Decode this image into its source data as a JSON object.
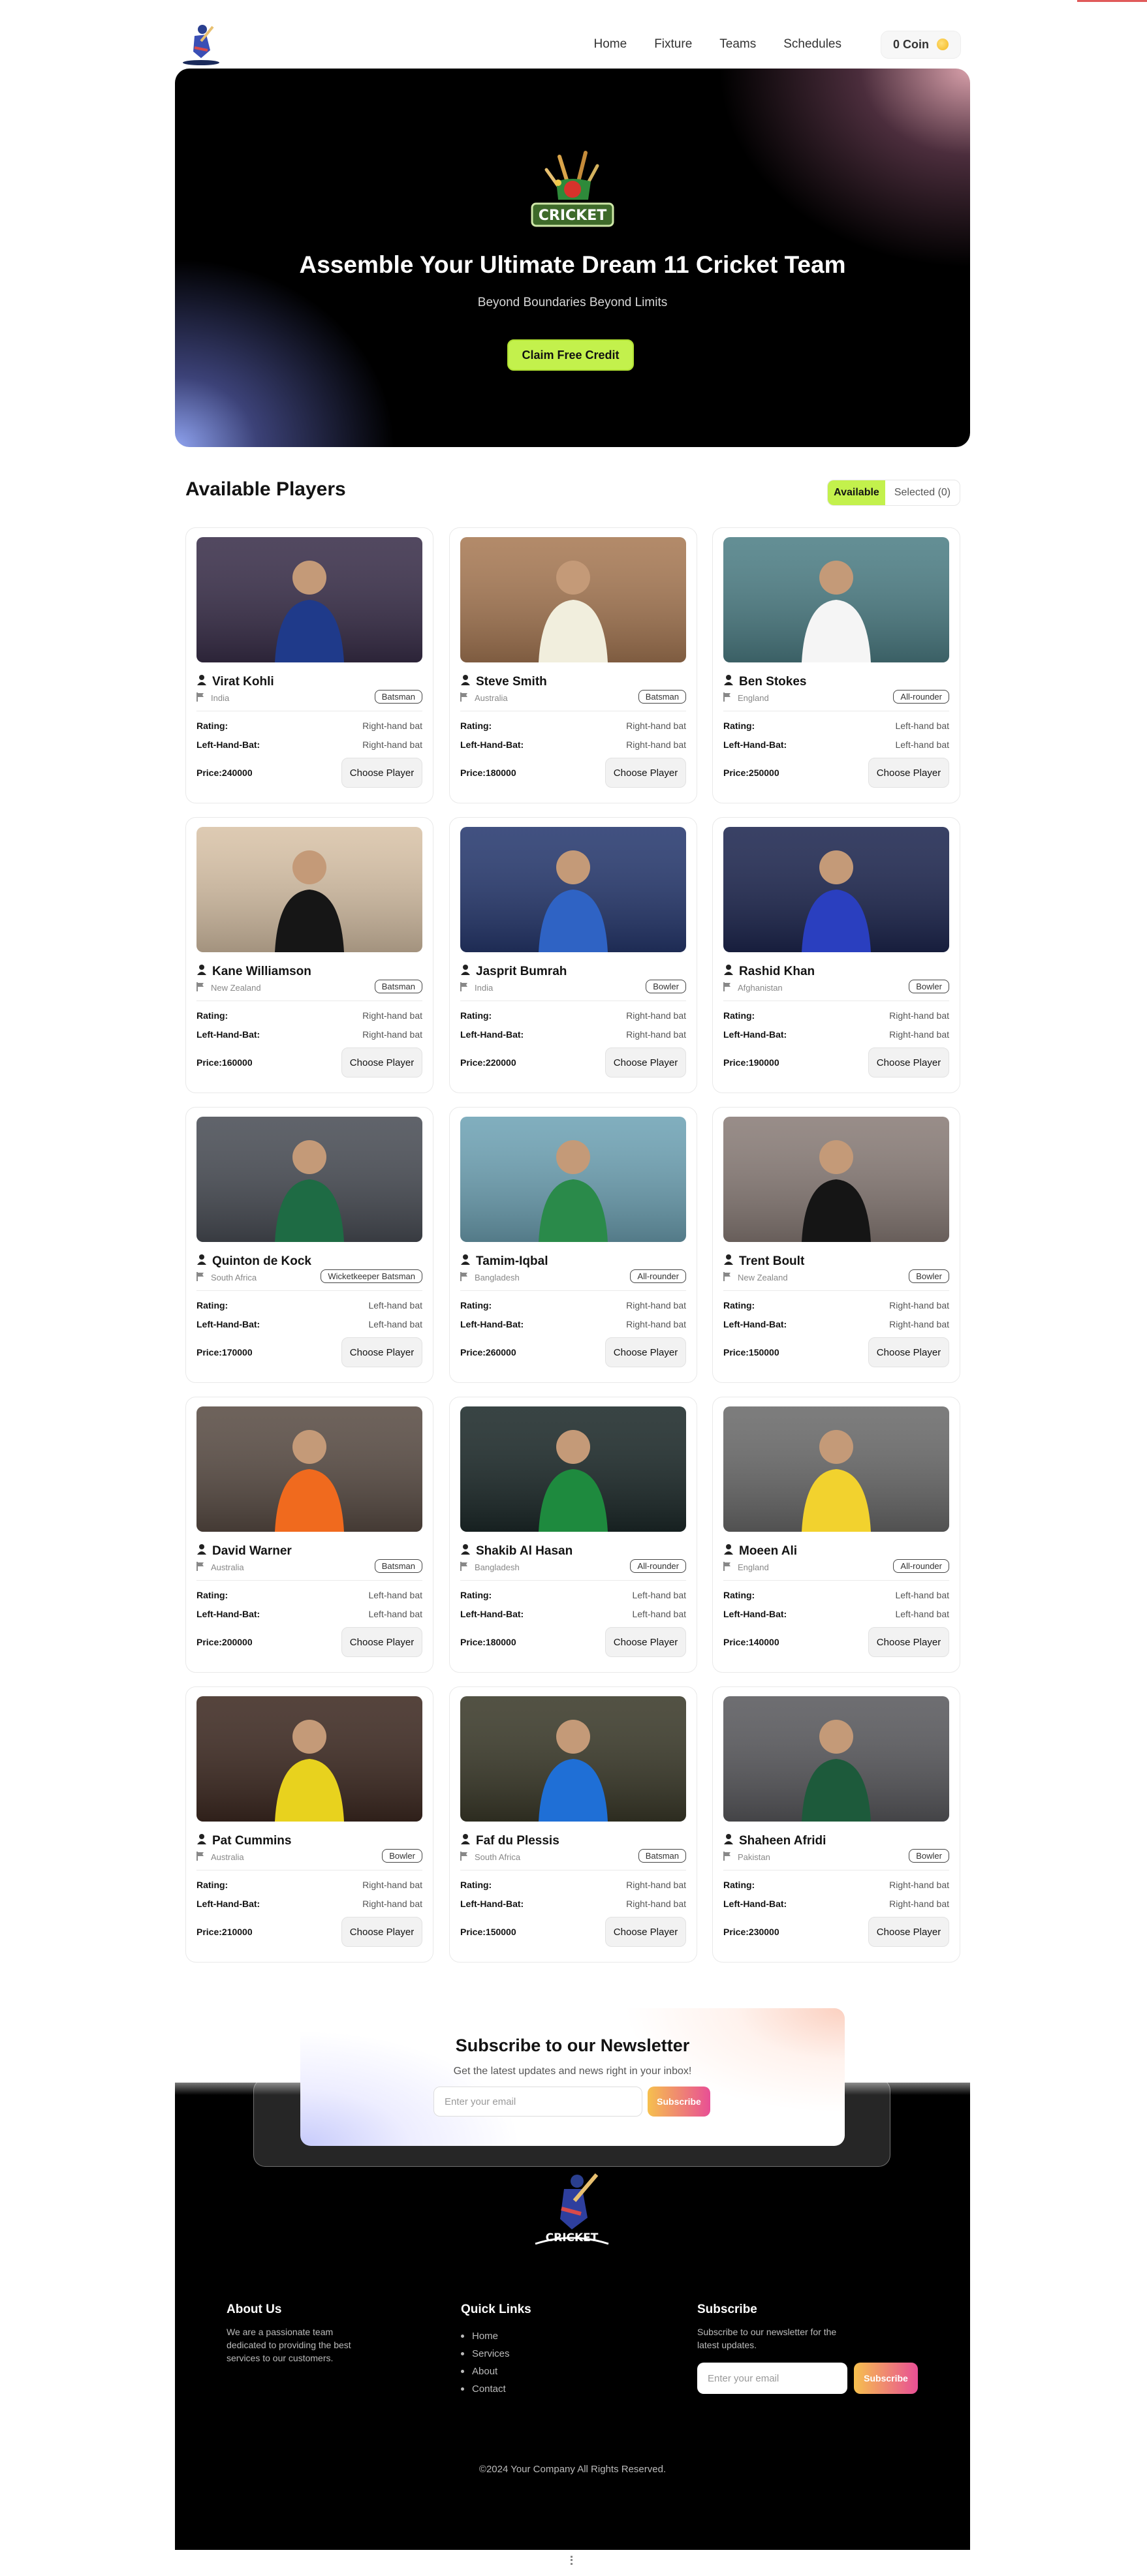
{
  "nav": {
    "links": [
      "Home",
      "Fixture",
      "Teams",
      "Schedules"
    ],
    "coin_label": "0 Coin"
  },
  "hero": {
    "banner_text": "CRICKET",
    "title": "Assemble Your Ultimate Dream 11 Cricket Team",
    "subtitle": "Beyond Boundaries Beyond Limits",
    "button": "Claim Free Credit"
  },
  "players_section": {
    "title": "Available Players",
    "tab_available": "Available",
    "tab_selected": "Selected (0)"
  },
  "labels": {
    "rating": "Rating:",
    "hand": "Left-Hand-Bat:",
    "choose": "Choose Player"
  },
  "players": [
    {
      "name": "Virat Kohli",
      "country": "India",
      "role": "Batsman",
      "rating": "Right-hand bat",
      "hand": "Right-hand bat",
      "price": "Price:240000",
      "jersey": "#1f3a8a",
      "bg": "#3a2f4a"
    },
    {
      "name": "Steve Smith",
      "country": "Australia",
      "role": "Batsman",
      "rating": "Right-hand bat",
      "hand": "Right-hand bat",
      "price": "Price:180000",
      "jersey": "#f1eedd",
      "bg": "#a87a55"
    },
    {
      "name": "Ben Stokes",
      "country": "England",
      "role": "All-rounder",
      "rating": "Left-hand bat",
      "hand": "Left-hand bat",
      "price": "Price:250000",
      "jersey": "#f5f5f5",
      "bg": "#4e7f86"
    },
    {
      "name": "Kane Williamson",
      "country": "New Zealand",
      "role": "Batsman",
      "rating": "Right-hand bat",
      "hand": "Right-hand bat",
      "price": "Price:160000",
      "jersey": "#161616",
      "bg": "#d9c3a8"
    },
    {
      "name": "Jasprit Bumrah",
      "country": "India",
      "role": "Bowler",
      "rating": "Right-hand bat",
      "hand": "Right-hand bat",
      "price": "Price:220000",
      "jersey": "#2f63c4",
      "bg": "#27396f"
    },
    {
      "name": "Rashid Khan",
      "country": "Afghanistan",
      "role": "Bowler",
      "rating": "Right-hand bat",
      "hand": "Right-hand bat",
      "price": "Price:190000",
      "jersey": "#2a3fbf",
      "bg": "#1e2750"
    },
    {
      "name": "Quinton de Kock",
      "country": "South Africa",
      "role": "Wicketkeeper Batsman",
      "rating": "Left-hand bat",
      "hand": "Left-hand bat",
      "price": "Price:170000",
      "jersey": "#1e6b44",
      "bg": "#4a4e56"
    },
    {
      "name": "Tamim-Iqbal",
      "country": "Bangladesh",
      "role": "All-rounder",
      "rating": "Right-hand bat",
      "hand": "Right-hand bat",
      "price": "Price:260000",
      "jersey": "#2a8a4a",
      "bg": "#6fa3b5"
    },
    {
      "name": "Trent Boult",
      "country": "New Zealand",
      "role": "Bowler",
      "rating": "Right-hand bat",
      "hand": "Right-hand bat",
      "price": "Price:150000",
      "jersey": "#151515",
      "bg": "#8a7d78"
    },
    {
      "name": "David Warner",
      "country": "Australia",
      "role": "Batsman",
      "rating": "Left-hand bat",
      "hand": "Left-hand bat",
      "price": "Price:200000",
      "jersey": "#f06a1e",
      "bg": "#5a4d45"
    },
    {
      "name": "Shakib Al Hasan",
      "country": "Bangladesh",
      "role": "All-rounder",
      "rating": "Left-hand bat",
      "hand": "Left-hand bat",
      "price": "Price:180000",
      "jersey": "#1e8a3e",
      "bg": "#1d2a2a"
    },
    {
      "name": "Moeen Ali",
      "country": "England",
      "role": "All-rounder",
      "rating": "Left-hand bat",
      "hand": "Left-hand bat",
      "price": "Price:140000",
      "jersey": "#f2d22e",
      "bg": "#6b6b6b"
    },
    {
      "name": "Pat Cummins",
      "country": "Australia",
      "role": "Bowler",
      "rating": "Right-hand bat",
      "hand": "Right-hand bat",
      "price": "Price:210000",
      "jersey": "#e8d21e",
      "bg": "#3e2a22"
    },
    {
      "name": "Faf du Plessis",
      "country": "South Africa",
      "role": "Batsman",
      "rating": "Right-hand bat",
      "hand": "Right-hand bat",
      "price": "Price:150000",
      "jersey": "#1f6fd6",
      "bg": "#3b3a2a"
    },
    {
      "name": "Shaheen Afridi",
      "country": "Pakistan",
      "role": "Bowler",
      "rating": "Right-hand bat",
      "hand": "Right-hand bat",
      "price": "Price:230000",
      "jersey": "#1d5a3b",
      "bg": "#5a5a5e"
    }
  ],
  "newsletter": {
    "title": "Subscribe to our Newsletter",
    "subtitle": "Get the latest updates and news right in your inbox!",
    "placeholder": "Enter your email",
    "button": "Subscribe"
  },
  "footer": {
    "logo_text": "CRICKET",
    "about_title": "About Us",
    "about_text": "We are a passionate team dedicated to providing the best services to our customers.",
    "links_title": "Quick Links",
    "links": [
      "Home",
      "Services",
      "About",
      "Contact"
    ],
    "subscribe_title": "Subscribe",
    "subscribe_text": "Subscribe to our newsletter for the latest updates.",
    "placeholder": "Enter your email",
    "button": "Subscribe",
    "copyright": "©2024 Your Company All Rights Reserved."
  },
  "colors": {
    "accent": "#c3f14c",
    "footer_bg": "#000000"
  }
}
